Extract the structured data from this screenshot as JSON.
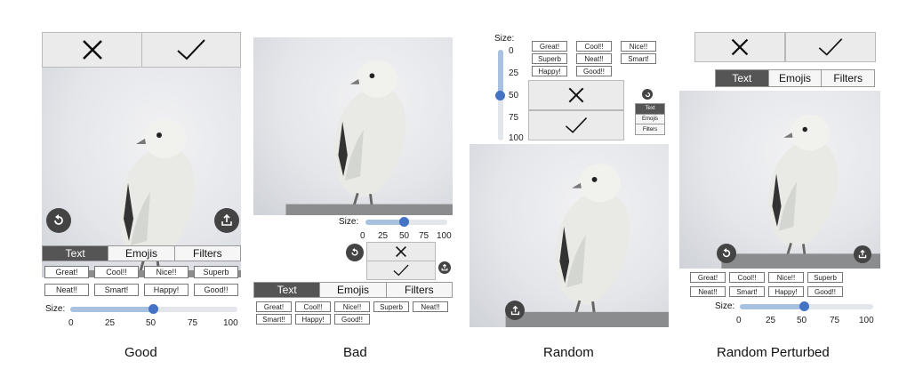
{
  "panels": [
    {
      "caption": "Good",
      "tabs": [
        "Text",
        "Emojis",
        "Filters"
      ],
      "chips": [
        "Great!",
        "Cool!!",
        "Nice!!",
        "Superb",
        "Neat!!",
        "Smart!",
        "Happy!",
        "Good!!"
      ],
      "size_label": "Size:",
      "ticks": [
        "0",
        "25",
        "50",
        "75",
        "100"
      ],
      "size_value": 50
    },
    {
      "caption": "Bad",
      "tabs": [
        "Text",
        "Emojis",
        "Filters"
      ],
      "chips": [
        "Great!",
        "Cool!!",
        "Nice!!",
        "Superb",
        "Neat!!",
        "Smart!!",
        "Happy!",
        "Good!!"
      ],
      "size_label": "Size:",
      "ticks": [
        "0",
        "25",
        "50",
        "75",
        "100"
      ],
      "size_value": 50
    },
    {
      "caption": "Random",
      "tabs": [
        "Text",
        "Emojis",
        "Filters"
      ],
      "chips": [
        "Great!",
        "Cool!!",
        "Nice!!",
        "Superb",
        "Neat!!",
        "Smart!",
        "Happy!",
        "Good!!"
      ],
      "size_label": "Size:",
      "ticks": [
        "0",
        "25",
        "50",
        "75",
        "100"
      ],
      "size_value": 50
    },
    {
      "caption": "Random Perturbed",
      "tabs": [
        "Text",
        "Emojis",
        "Filters"
      ],
      "chips": [
        "Great!",
        "Cool!!",
        "Nice!!",
        "Superb",
        "Neat!!",
        "Smart!",
        "Happy!",
        "Good!!"
      ],
      "size_label": "Size:",
      "ticks": [
        "0",
        "25",
        "50",
        "75",
        "100"
      ],
      "size_value": 50
    }
  ],
  "icons": {
    "close": "close-icon",
    "confirm": "checkmark-icon",
    "reset": "reset-icon",
    "share": "share-icon"
  },
  "colors": {
    "active_tab": "#555555",
    "slider_knob": "#4472c4",
    "slider_fill": "#a9c1e0"
  }
}
